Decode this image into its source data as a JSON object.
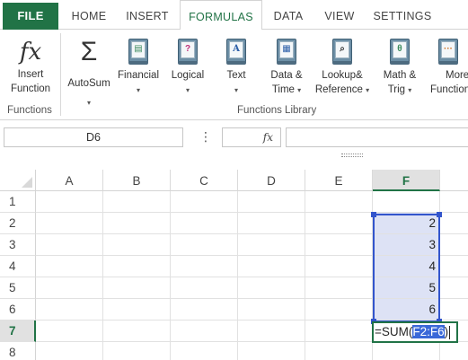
{
  "tabs": [
    {
      "label": "FILE"
    },
    {
      "label": "HOME"
    },
    {
      "label": "INSERT"
    },
    {
      "label": "FORMULAS"
    },
    {
      "label": "DATA"
    },
    {
      "label": "VIEW"
    },
    {
      "label": "SETTINGS"
    }
  ],
  "ribbon": {
    "insert_function": {
      "icon": "fx",
      "line1": "Insert",
      "line2": "Function"
    },
    "autosum": {
      "icon": "Σ",
      "label": "AutoSum",
      "caret": "▾"
    },
    "financial": {
      "label": "Financial",
      "caret": "▾"
    },
    "logical": {
      "label": "Logical",
      "glyph": "?",
      "caret": "▾"
    },
    "text": {
      "label": "Text",
      "glyph": "A",
      "caret": "▾"
    },
    "date_time": {
      "line1": "Data &",
      "line2": "Time",
      "caret": "▾"
    },
    "lookup": {
      "line1": "Lookup&",
      "line2": "Reference",
      "caret": "▾"
    },
    "math": {
      "line1": "Math &",
      "line2": "Trig",
      "glyph": "θ",
      "caret": "▾"
    },
    "more": {
      "line1": "More",
      "line2": "Functions",
      "glyph": "···"
    },
    "groups": {
      "functions": "Functions",
      "library": "Functions Library"
    }
  },
  "formula_bar": {
    "name_box": "D6",
    "menu_dots": "⋮",
    "fx_label": "fx",
    "value": ""
  },
  "grid": {
    "columns": [
      "A",
      "B",
      "C",
      "D",
      "E",
      "F"
    ],
    "selected_column": "F",
    "rows": [
      "1",
      "2",
      "3",
      "4",
      "5",
      "6",
      "7",
      "8"
    ],
    "selected_row": "7",
    "f_values": [
      "",
      "2",
      "3",
      "4",
      "5",
      "6"
    ],
    "edit_cell": {
      "prefix": "=SUM(",
      "highlight": "F2:F6",
      "suffix": ")"
    }
  },
  "colors": {
    "excel_green": "#217346",
    "reference_blue": "#3355cc",
    "reference_fill": "#dde2f5",
    "selection_highlight": "#3a68d8"
  }
}
